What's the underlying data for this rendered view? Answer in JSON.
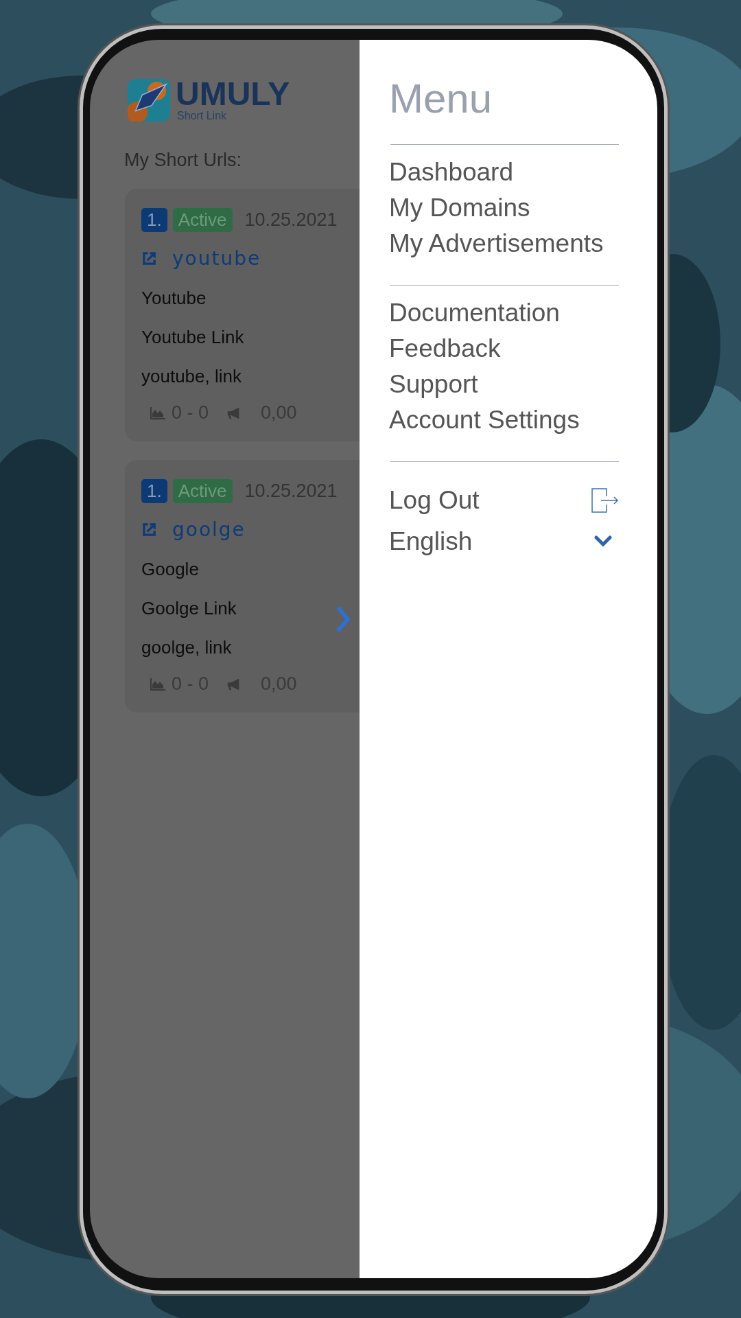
{
  "logo": {
    "name": "UMULY",
    "tagline": "Short Link"
  },
  "heading": "My Short Urls:",
  "urls": [
    {
      "index": "1.",
      "status": "Active",
      "active": true,
      "date": "10.25.2021",
      "slug": "youtube",
      "title": "Youtube",
      "description": "Youtube Link",
      "tags": "youtube, link",
      "clicks": "0 - 0",
      "earnings": "0,00"
    },
    {
      "index": "1.",
      "status": "Active",
      "active": true,
      "date": "10.25.2021",
      "slug": "goolge",
      "title": "Google",
      "description": "Goolge Link",
      "tags": "goolge, link",
      "clicks": "0 - 0",
      "earnings": "0,00"
    }
  ],
  "menu": {
    "title": "Menu",
    "groups": [
      [
        "Dashboard",
        "My Domains",
        "My Advertisements"
      ],
      [
        "Documentation",
        "Feedback",
        "Support",
        "Account Settings"
      ]
    ],
    "logout": "Log Out",
    "language": "English"
  }
}
